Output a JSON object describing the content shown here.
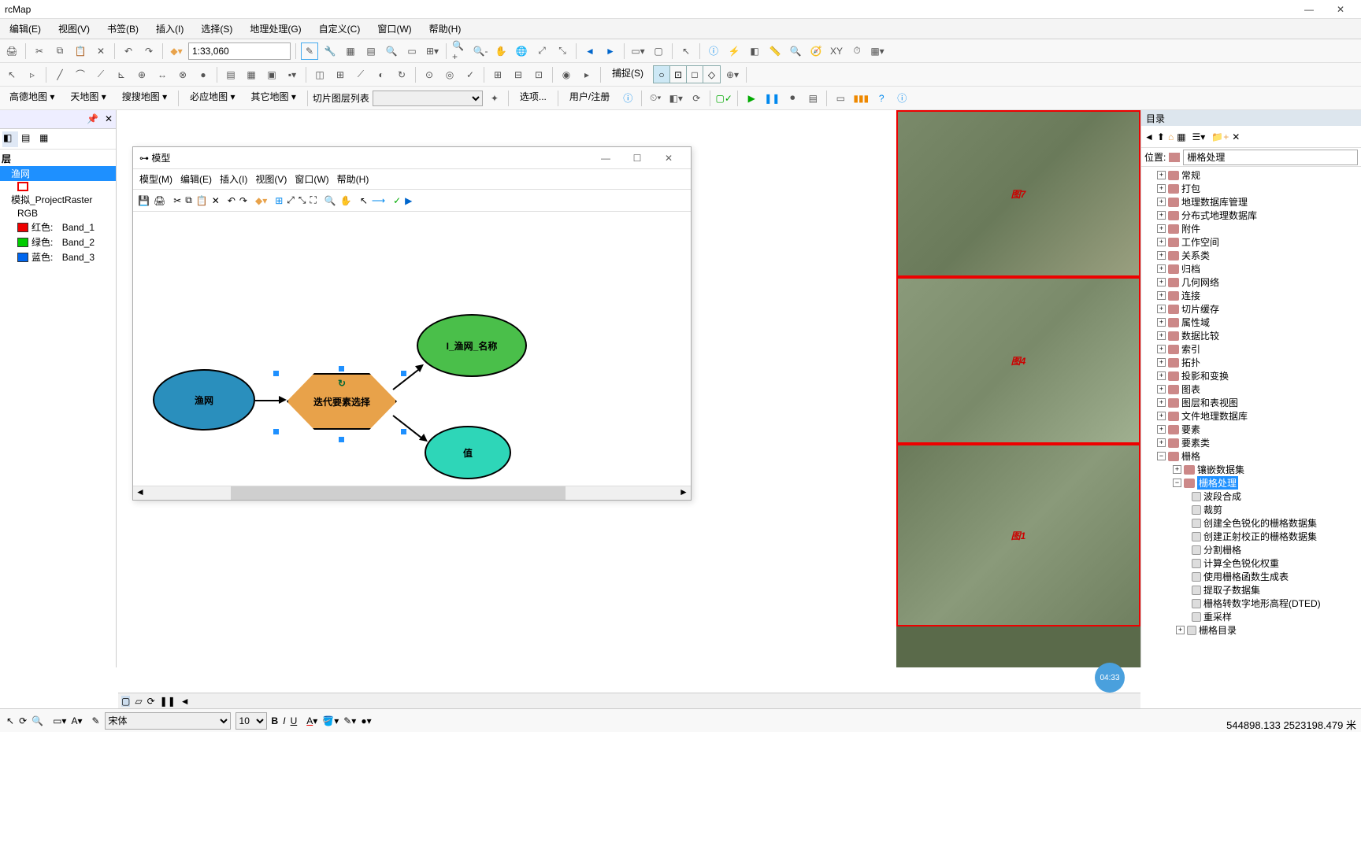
{
  "app_title": "rcMap",
  "menu": {
    "main": [
      "编辑(E)",
      "视图(V)",
      "书签(B)",
      "插入(I)",
      "选择(S)",
      "地理处理(G)",
      "自定义(C)",
      "窗口(W)",
      "帮助(H)"
    ],
    "model": [
      "模型(M)",
      "编辑(E)",
      "插入(I)",
      "视图(V)",
      "窗口(W)",
      "帮助(H)"
    ]
  },
  "scale": "1:33,060",
  "snap_label": "捕捉(S)",
  "map_tabs": [
    "高德地图",
    "天地图",
    "搜搜地图"
  ],
  "map_more": [
    "必应地图",
    "其它地图"
  ],
  "tile_label": "切片图层列表",
  "opts": {
    "options": "选项...",
    "user": "用户/注册"
  },
  "toc": {
    "root": "层",
    "layer_sel": "渔网",
    "raster": "模拟_ProjectRaster",
    "rgb": "RGB",
    "bands": [
      {
        "label": "红色:",
        "name": "Band_1",
        "color": "#e00"
      },
      {
        "label": "绿色:",
        "name": "Band_2",
        "color": "#0c0"
      },
      {
        "label": "蓝色:",
        "name": "Band_3",
        "color": "#06e"
      }
    ]
  },
  "model_win": {
    "title": "模型",
    "nodes": {
      "input": "渔网",
      "process": "迭代要素选择",
      "out1": "I_渔网_名称",
      "out2": "值"
    }
  },
  "map_labels": [
    "图7",
    "图4",
    "图1"
  ],
  "catalog": {
    "title": "目录",
    "loc_label": "位置:",
    "loc_value": "栅格处理",
    "items": [
      "常规",
      "打包",
      "地理数据库管理",
      "分布式地理数据库",
      "附件",
      "工作空间",
      "关系类",
      "归档",
      "几何网络",
      "连接",
      "切片缓存",
      "属性域",
      "数据比较",
      "索引",
      "拓扑",
      "投影和变换",
      "图表",
      "图层和表视图",
      "文件地理数据库",
      "要素",
      "要素类",
      "栅格"
    ],
    "raster_children": [
      "镶嵌数据集",
      "栅格处理"
    ],
    "tools": [
      "波段合成",
      "裁剪",
      "创建全色锐化的栅格数据集",
      "创建正射校正的栅格数据集",
      "分割栅格",
      "计算全色锐化权重",
      "使用栅格函数生成表",
      "提取子数据集",
      "栅格转数字地形高程(DTED)",
      "重采样",
      "栅格目录"
    ]
  },
  "draw": {
    "font": "宋体",
    "size": "10"
  },
  "coords": "544898.133 2523198.479 米",
  "timer": "04:33"
}
